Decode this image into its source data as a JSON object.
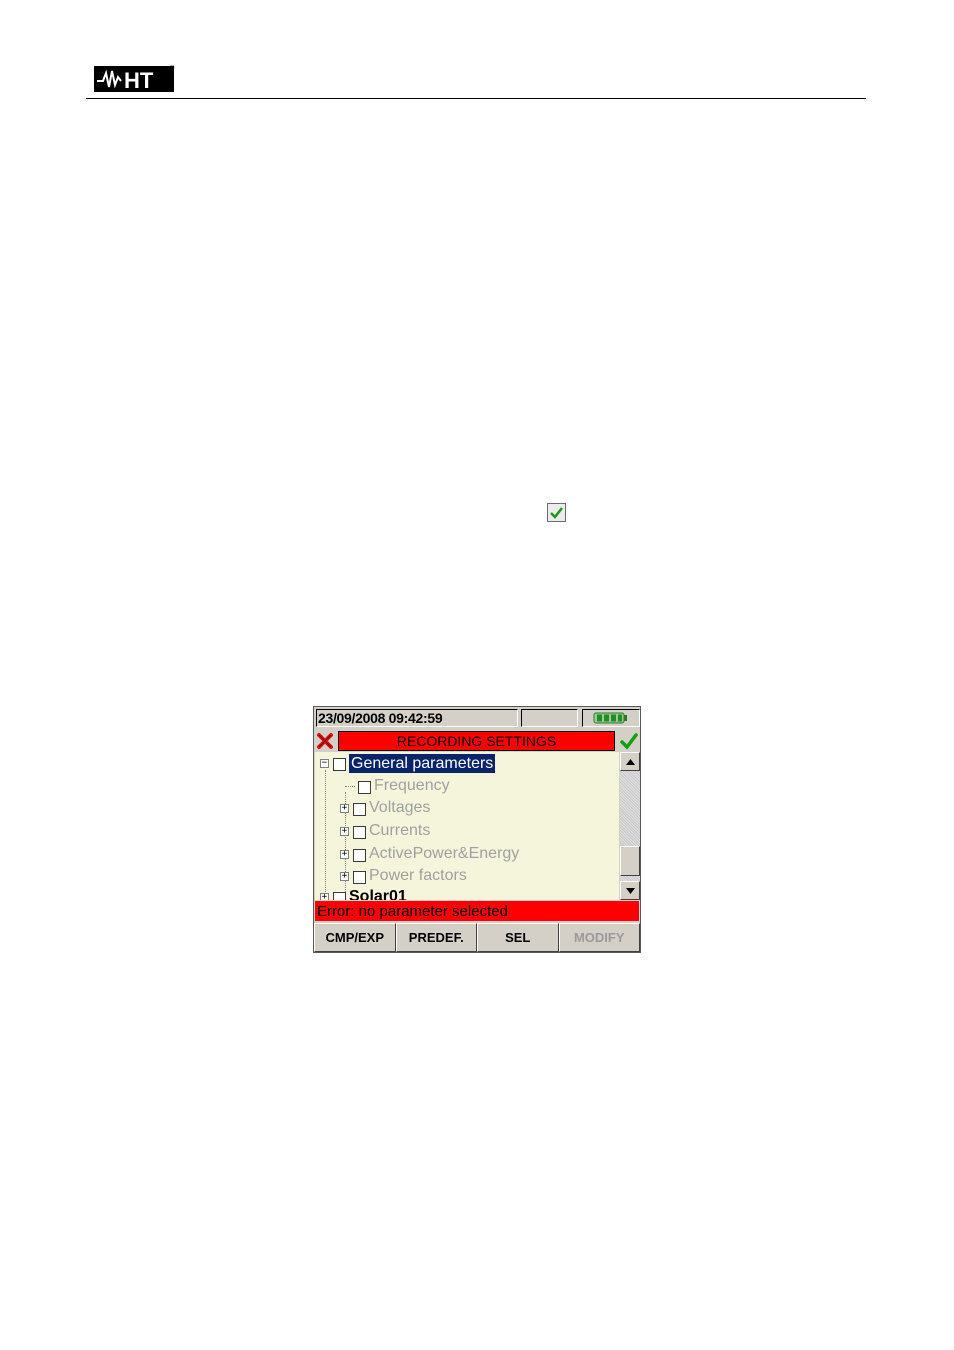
{
  "header": {
    "logo_text": "HT",
    "logo_mark": "®"
  },
  "instrument": {
    "status": {
      "datetime": "23/09/2008 09:42:59",
      "battery_icon": "battery-full-icon"
    },
    "title": "RECORDING SETTINGS",
    "cancel_icon": "red-x-icon",
    "confirm_icon": "green-check-icon",
    "tree": [
      {
        "label": "General parameters",
        "state": "selected",
        "expander": "⊟"
      },
      {
        "label": "Frequency",
        "state": "disabled"
      },
      {
        "label": "Voltages",
        "state": "disabled",
        "expander": "⊞"
      },
      {
        "label": "Currents",
        "state": "disabled",
        "expander": "⊞"
      },
      {
        "label": "ActivePower&Energy",
        "state": "disabled",
        "expander": "⊞"
      },
      {
        "label": "Power factors",
        "state": "disabled",
        "expander": "⊞"
      },
      {
        "label": "Solar01",
        "state": "partial"
      }
    ],
    "error_message": "Error: no parameter selected",
    "softkeys": [
      {
        "label": "CMP/EXP",
        "enabled": true
      },
      {
        "label": "PREDEF.",
        "enabled": true
      },
      {
        "label": "SEL",
        "enabled": true
      },
      {
        "label": "MODIFY",
        "enabled": false
      }
    ]
  },
  "colors": {
    "title_bg": "#ff0000",
    "error_bg": "#ff0000",
    "tree_bg": "#f5f5dc",
    "selection": "#0a246a"
  }
}
